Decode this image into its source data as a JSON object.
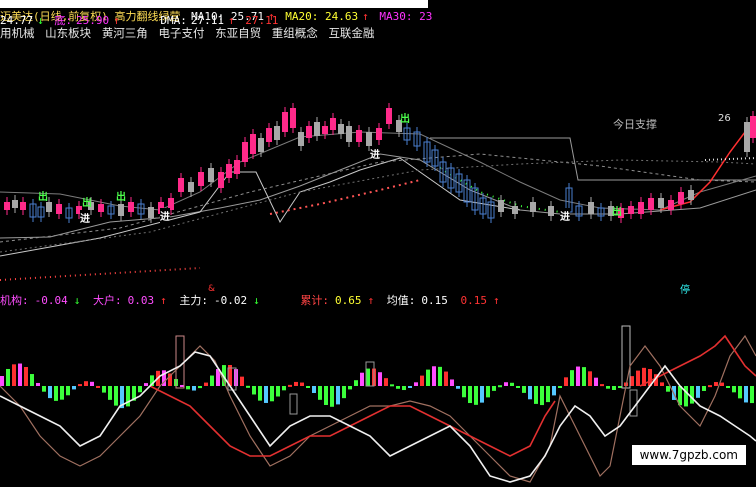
{
  "header": {
    "title": "迈美达(日线,前复权) 高力翻线绿营",
    "ma10": "MA10: 25.71",
    "ma10_arrow": "↑",
    "ma20": "MA20: 24.63",
    "ma20_arrow": "↑",
    "ma30_label": "MA30: 23",
    "low": "24.77",
    "low_arrow": "↓",
    "di_label": "底:",
    "di_value": "25.90",
    "di_arrow": "↑",
    "dma": "DMA:",
    "dma_value": "27.11",
    "dma_arrow": "↑",
    "dma_value2": "27.11"
  },
  "sectors": [
    "用机械",
    "山东板块",
    "黄河三角",
    "电子支付",
    "东亚自贸",
    "重组概念",
    "互联金融"
  ],
  "price_chart": {
    "support_label": "今日支撑",
    "right_value": "26",
    "entry_label": "进",
    "exit_label": "出",
    "marker_amp": "&",
    "marker_ting": "停"
  },
  "indicator": {
    "jigou_label": "机构:",
    "jigou_value": "-0.04",
    "jigou_arrow": "↓",
    "dahu_label": "大户:",
    "dahu_value": "0.03",
    "dahu_arrow": "↑",
    "zhuli_label": "主力:",
    "zhuli_value": "-0.02",
    "zhuli_arrow": "↓",
    "leiji_label": "累计:",
    "leiji_value": "0.65",
    "leiji_arrow": "↑",
    "junzhi_label": "均值:",
    "junzhi_value": "0.15",
    "junzhi_value2": "0.15",
    "junzhi_arrow": "↑"
  },
  "watermark": "www.7gpzb.com",
  "colors": {
    "up": "#ff2a8a",
    "down": "#4a7fd0",
    "flat": "#a8a8a8",
    "accent_green": "#3cff3c",
    "accent_red": "#ff3030",
    "label_magenta": "#ff4dff",
    "label_yellow": "#ffff33"
  }
}
